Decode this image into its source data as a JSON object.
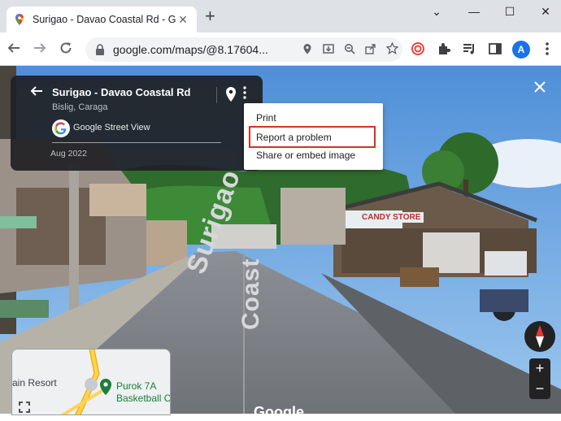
{
  "browser": {
    "tab_title": "Surigao - Davao Coastal Rd - Goo",
    "tab_close": "✕",
    "new_tab": "+",
    "url": "google.com/maps/@8.17604...",
    "profile_initial": "A",
    "window_controls": [
      "⌄",
      "—",
      "☐",
      "✕"
    ]
  },
  "infocard": {
    "title": "Surigao - Davao Coastal Rd",
    "subtitle": "Bislig, Caraga",
    "source": "Google Street View",
    "date": "Aug 2022",
    "back_glyph": "🡐",
    "more_glyph": "⋮"
  },
  "menu": {
    "items": [
      "Print",
      "Report a problem",
      "Share or embed image"
    ],
    "highlighted_item": "Report a problem",
    "highlight_color": "#d93025"
  },
  "scene": {
    "road_label_1": "Surigao",
    "road_label_2": "Coast",
    "store_sign": "CANDY STORE",
    "close_glyph": "✕"
  },
  "minimap": {
    "place_label": "Purok 7A Basketball C",
    "place_label_line1": "Purok 7A",
    "place_label_line2": "Basketball C",
    "resort_label": "ain Resort"
  },
  "controls": {
    "zoom_in": "+",
    "zoom_out": "−",
    "watermark": "Google"
  },
  "colors": {
    "accent": "#1a73e8",
    "pin_green": "#188038",
    "sky": "#6aa7e0"
  }
}
